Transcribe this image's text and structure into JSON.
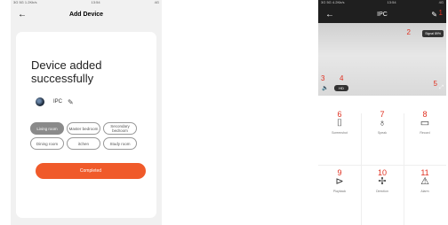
{
  "left": {
    "status_left": "3G 5G 1.2Kb/s",
    "status_time": "13:54",
    "status_right": "4G",
    "title": "Add Device",
    "back_glyph": "←",
    "headline": "Device added successfully",
    "device_name": "IPC",
    "rooms": [
      "Living room",
      "Master bedroom",
      "Secondary bedroom",
      "Dining room",
      "itchen",
      "Study room"
    ],
    "complete_label": "Completed"
  },
  "right": {
    "status_left": "3G 5G 4.2Kb/s",
    "status_time": "13:54",
    "status_right": "4G",
    "title": "IPC",
    "back_glyph": "←",
    "signal": "Signal 89%",
    "hd_label": "HD",
    "markers": {
      "m1": "1",
      "m2": "2",
      "m3": "3",
      "m4": "4",
      "m5": "5"
    },
    "controls": [
      {
        "num": "6",
        "label": "Screenshot",
        "icon": "camera-icon"
      },
      {
        "num": "7",
        "label": "Speak",
        "icon": "microphone-icon"
      },
      {
        "num": "8",
        "label": "Record",
        "icon": "video-record-icon"
      },
      {
        "num": "9",
        "label": "Playback",
        "icon": "playback-icon"
      },
      {
        "num": "10",
        "label": "Direction",
        "icon": "direction-icon"
      },
      {
        "num": "11",
        "label": "Alarm",
        "icon": "alarm-icon"
      }
    ]
  }
}
